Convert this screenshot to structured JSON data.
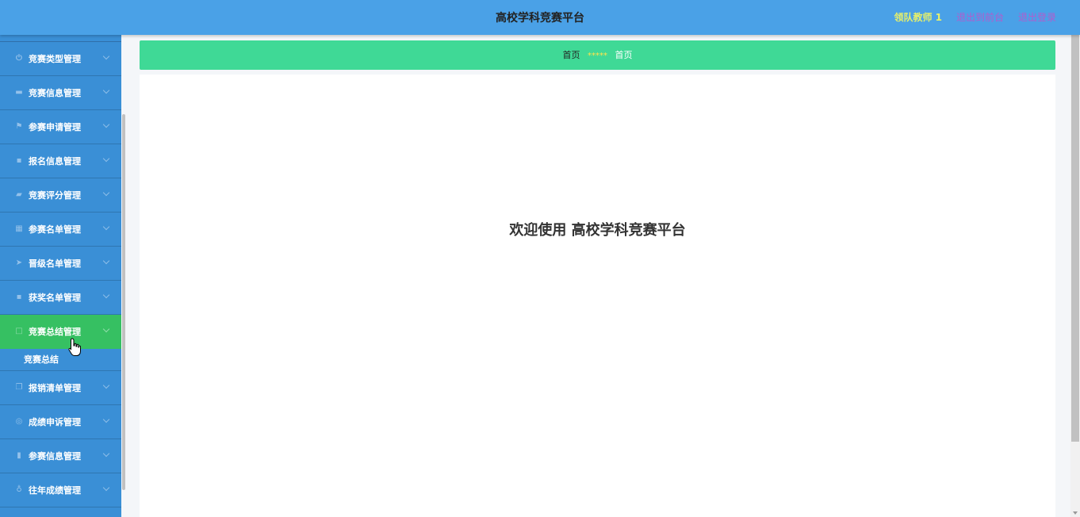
{
  "header": {
    "title": "高校学科竞赛平台",
    "user": "领队教师 1",
    "goto_front": "退出到前台",
    "logout": "退出登录"
  },
  "sidebar": {
    "items": [
      {
        "label": "竞赛类型管理",
        "icon": "power-icon"
      },
      {
        "label": "竞赛信息管理",
        "icon": "briefcase-icon"
      },
      {
        "label": "参赛申请管理",
        "icon": "flag-icon"
      },
      {
        "label": "报名信息管理",
        "icon": "clipboard-icon"
      },
      {
        "label": "竞赛评分管理",
        "icon": "comment-icon"
      },
      {
        "label": "参赛名单管理",
        "icon": "grid-icon"
      },
      {
        "label": "晋级名单管理",
        "icon": "send-icon"
      },
      {
        "label": "获奖名单管理",
        "icon": "award-icon"
      },
      {
        "label": "竞赛总结管理",
        "icon": "square-icon",
        "active": true
      },
      {
        "label": "报销清单管理",
        "icon": "copy-icon"
      },
      {
        "label": "成绩申诉管理",
        "icon": "globe-icon"
      },
      {
        "label": "参赛信息管理",
        "icon": "library-icon"
      },
      {
        "label": "往年成绩管理",
        "icon": "microphone-icon"
      }
    ],
    "submenu": {
      "label": "竞赛总结"
    }
  },
  "breadcrumb": {
    "home": "首页",
    "separator": "*****",
    "current": "首页"
  },
  "main": {
    "welcome": "欢迎使用 高校学科竞赛平台"
  },
  "colors": {
    "header_bg": "#4aa1e7",
    "sidebar_bg": "#3a8fd6",
    "active_bg": "#36c062",
    "breadcrumb_bg": "#3fd996"
  }
}
